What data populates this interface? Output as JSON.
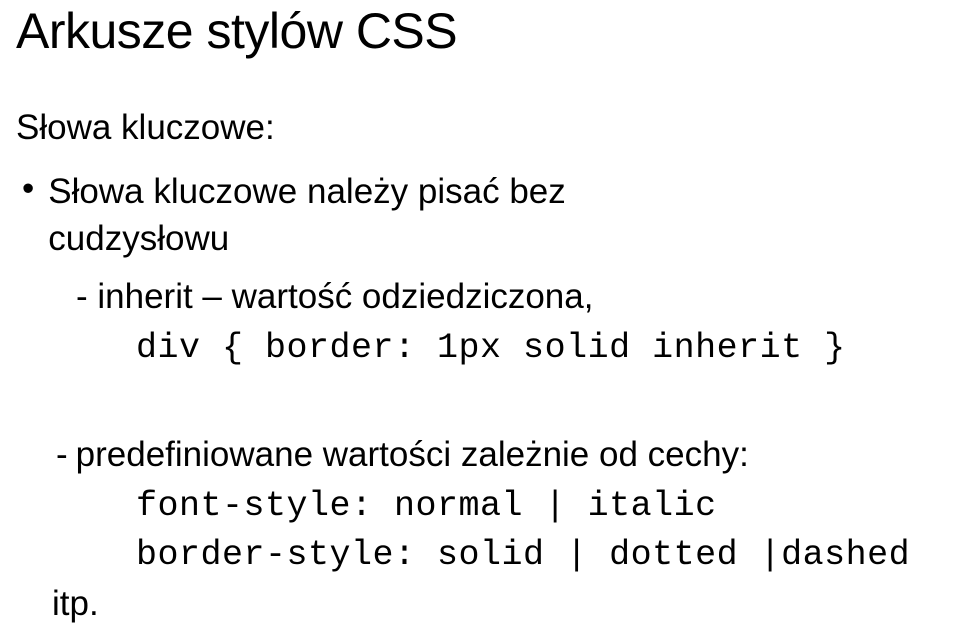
{
  "title": "Arkusze stylów CSS",
  "subtitle": "Słowa kluczowe:",
  "bullet1": {
    "line1": "Słowa kluczowe należy pisać bez",
    "line2": "cudzysłowu"
  },
  "item1": {
    "desc": "- inherit – wartość odziedziczona,",
    "code": "div { border: 1px solid inherit }"
  },
  "item2": {
    "desc": "predefiniowane wartości zależnie od cechy:",
    "dash": "-",
    "code1": "font-style: normal | italic",
    "code2": "border-style: solid | dotted |dashed"
  },
  "etc": "itp."
}
